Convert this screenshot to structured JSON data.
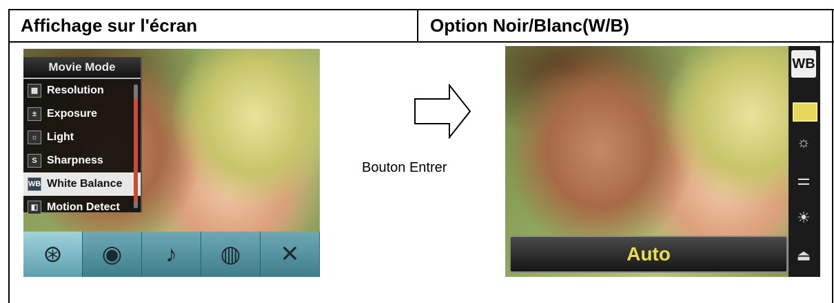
{
  "headers": {
    "left": "Affichage sur l'écran",
    "right": "Option Noir/Blanc(W/B)"
  },
  "left_screen": {
    "menu_title": "Movie Mode",
    "menu_items": [
      {
        "label": "Resolution",
        "icon": "resolution-icon"
      },
      {
        "label": "Exposure",
        "icon": "exposure-icon"
      },
      {
        "label": "Light",
        "icon": "light-icon"
      },
      {
        "label": "Sharpness",
        "icon": "sharpness-icon"
      },
      {
        "label": "White Balance",
        "icon": "white-balance-icon",
        "selected": true
      },
      {
        "label": "Motion Detect",
        "icon": "motion-detect-icon"
      }
    ],
    "mode_icons": [
      "movie-reel-icon",
      "camera-icon",
      "microphone-icon",
      "palette-icon",
      "tools-icon"
    ]
  },
  "middle": {
    "button_label": "Bouton Entrer",
    "arrow_icon": "right-arrow-icon"
  },
  "right_screen": {
    "badge": "WB",
    "value": "Auto",
    "options": [
      "auto-icon",
      "daylight-icon",
      "fluorescent-icon",
      "tungsten-icon",
      "exit-icon"
    ],
    "accent_color": "#e9de4a"
  }
}
